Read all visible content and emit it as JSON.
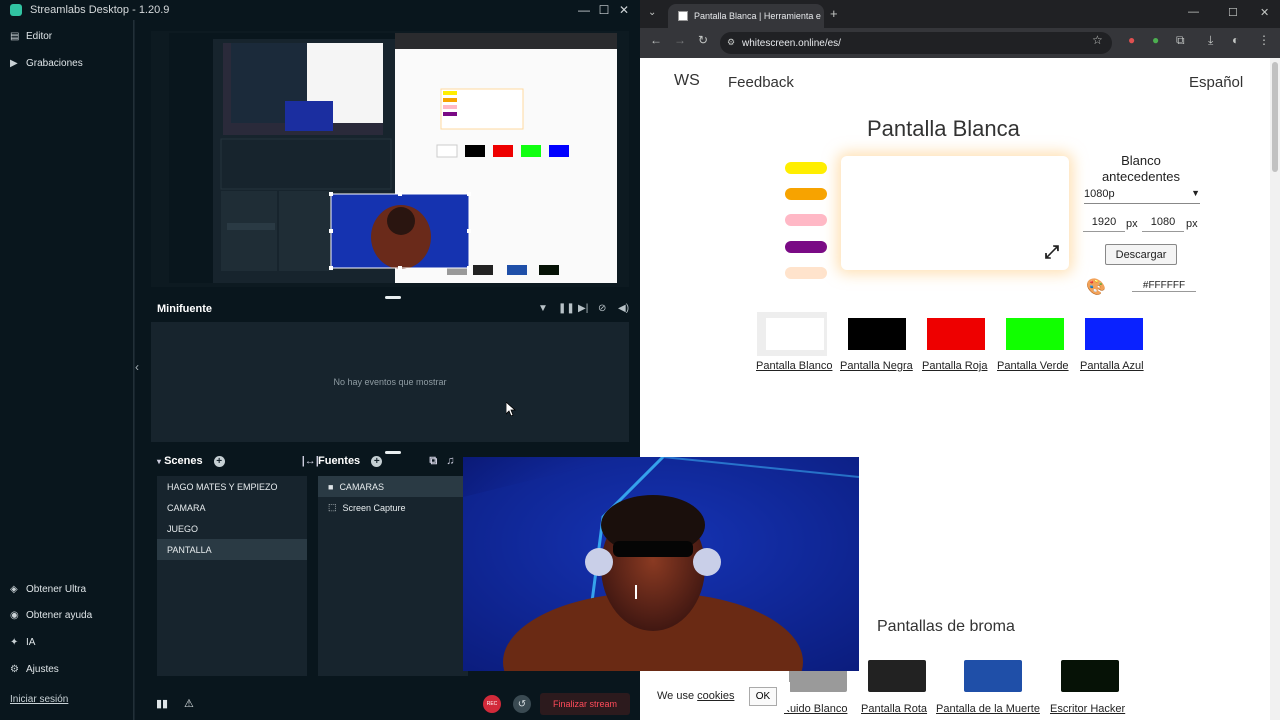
{
  "streamlabs": {
    "title": "Streamlabs Desktop - 1.20.9",
    "window_controls": [
      "—",
      "☐",
      "✕"
    ],
    "sidebar": {
      "top": [
        {
          "label": "Editor",
          "icon": "editor-icon"
        },
        {
          "label": "Grabaciones",
          "icon": "recordings-icon"
        }
      ],
      "bottom": [
        {
          "label": "Obtener Ultra",
          "icon": "ultra-icon"
        },
        {
          "label": "Obtener ayuda",
          "icon": "help-icon"
        },
        {
          "label": "IA",
          "icon": "ai-icon"
        },
        {
          "label": "Ajustes",
          "icon": "settings-icon"
        }
      ],
      "login": "Iniciar sesión"
    },
    "mini_source": {
      "title": "Minifuente",
      "empty": "No hay eventos que mostrar"
    },
    "scenes": {
      "title": "Scenes",
      "items": [
        "HAGO MATES Y EMPIEZO",
        "CAMARA",
        "JUEGO",
        "PANTALLA"
      ],
      "selected": "PANTALLA"
    },
    "sources": {
      "title": "Fuentes",
      "items": [
        {
          "label": "CAMARAS",
          "icon": "folder-icon"
        },
        {
          "label": "Screen Capture",
          "icon": "screen-capture-icon"
        }
      ]
    },
    "footer": {
      "rec": "REC",
      "end_stream": "Finalizar stream"
    }
  },
  "chrome": {
    "tab_title": "Pantalla Blanca | Herramienta e",
    "url": "whitescreen.online/es/",
    "page": {
      "logo": "WS",
      "feedback": "Feedback",
      "language": "Español",
      "title": "Pantalla Blanca",
      "swatches": [
        "#ffee00",
        "#f7a300",
        "#ffb8c6",
        "#7a0a85",
        "#ffe3cc"
      ],
      "options_title": "Blanco antecedentes",
      "resolution": "1080p",
      "width": "1920",
      "height": "1080",
      "px": "px",
      "download": "Descargar",
      "hex": "#FFFFFF",
      "colors": [
        {
          "label": "Pantalla Blanco",
          "color": "#ffffff"
        },
        {
          "label": "Pantalla Negra",
          "color": "#000000"
        },
        {
          "label": "Pantalla Roja",
          "color": "#ee0000"
        },
        {
          "label": "Pantalla Verde",
          "color": "#11ff00"
        },
        {
          "label": "Pantalla Azul",
          "color": "#0a22ff"
        }
      ],
      "prank_title": "Pantallas de broma",
      "pranks": [
        {
          "label": "Ruido Blanco",
          "color": "#9a9a9a"
        },
        {
          "label": "Pantalla Rota",
          "color": "#222222"
        },
        {
          "label": "Pantalla de la Muerte",
          "color": "#1f4fa8"
        },
        {
          "label": "Escritor Hacker",
          "color": "#061206"
        }
      ],
      "cookie_text": "We use ",
      "cookie_link": "cookies",
      "cookie_ok": "OK"
    }
  }
}
